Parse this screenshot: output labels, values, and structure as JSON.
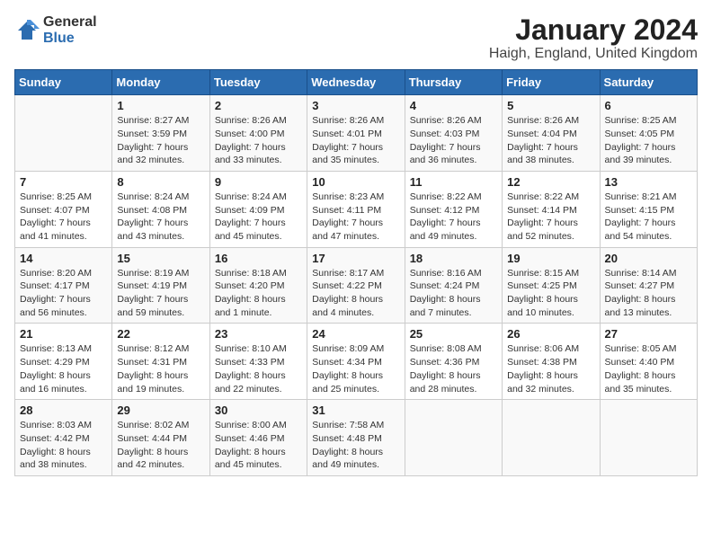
{
  "logo": {
    "general": "General",
    "blue": "Blue"
  },
  "header": {
    "title": "January 2024",
    "subtitle": "Haigh, England, United Kingdom"
  },
  "weekdays": [
    "Sunday",
    "Monday",
    "Tuesday",
    "Wednesday",
    "Thursday",
    "Friday",
    "Saturday"
  ],
  "weeks": [
    [
      {
        "day": "",
        "info": ""
      },
      {
        "day": "1",
        "info": "Sunrise: 8:27 AM\nSunset: 3:59 PM\nDaylight: 7 hours\nand 32 minutes."
      },
      {
        "day": "2",
        "info": "Sunrise: 8:26 AM\nSunset: 4:00 PM\nDaylight: 7 hours\nand 33 minutes."
      },
      {
        "day": "3",
        "info": "Sunrise: 8:26 AM\nSunset: 4:01 PM\nDaylight: 7 hours\nand 35 minutes."
      },
      {
        "day": "4",
        "info": "Sunrise: 8:26 AM\nSunset: 4:03 PM\nDaylight: 7 hours\nand 36 minutes."
      },
      {
        "day": "5",
        "info": "Sunrise: 8:26 AM\nSunset: 4:04 PM\nDaylight: 7 hours\nand 38 minutes."
      },
      {
        "day": "6",
        "info": "Sunrise: 8:25 AM\nSunset: 4:05 PM\nDaylight: 7 hours\nand 39 minutes."
      }
    ],
    [
      {
        "day": "7",
        "info": "Sunrise: 8:25 AM\nSunset: 4:07 PM\nDaylight: 7 hours\nand 41 minutes."
      },
      {
        "day": "8",
        "info": "Sunrise: 8:24 AM\nSunset: 4:08 PM\nDaylight: 7 hours\nand 43 minutes."
      },
      {
        "day": "9",
        "info": "Sunrise: 8:24 AM\nSunset: 4:09 PM\nDaylight: 7 hours\nand 45 minutes."
      },
      {
        "day": "10",
        "info": "Sunrise: 8:23 AM\nSunset: 4:11 PM\nDaylight: 7 hours\nand 47 minutes."
      },
      {
        "day": "11",
        "info": "Sunrise: 8:22 AM\nSunset: 4:12 PM\nDaylight: 7 hours\nand 49 minutes."
      },
      {
        "day": "12",
        "info": "Sunrise: 8:22 AM\nSunset: 4:14 PM\nDaylight: 7 hours\nand 52 minutes."
      },
      {
        "day": "13",
        "info": "Sunrise: 8:21 AM\nSunset: 4:15 PM\nDaylight: 7 hours\nand 54 minutes."
      }
    ],
    [
      {
        "day": "14",
        "info": "Sunrise: 8:20 AM\nSunset: 4:17 PM\nDaylight: 7 hours\nand 56 minutes."
      },
      {
        "day": "15",
        "info": "Sunrise: 8:19 AM\nSunset: 4:19 PM\nDaylight: 7 hours\nand 59 minutes."
      },
      {
        "day": "16",
        "info": "Sunrise: 8:18 AM\nSunset: 4:20 PM\nDaylight: 8 hours\nand 1 minute."
      },
      {
        "day": "17",
        "info": "Sunrise: 8:17 AM\nSunset: 4:22 PM\nDaylight: 8 hours\nand 4 minutes."
      },
      {
        "day": "18",
        "info": "Sunrise: 8:16 AM\nSunset: 4:24 PM\nDaylight: 8 hours\nand 7 minutes."
      },
      {
        "day": "19",
        "info": "Sunrise: 8:15 AM\nSunset: 4:25 PM\nDaylight: 8 hours\nand 10 minutes."
      },
      {
        "day": "20",
        "info": "Sunrise: 8:14 AM\nSunset: 4:27 PM\nDaylight: 8 hours\nand 13 minutes."
      }
    ],
    [
      {
        "day": "21",
        "info": "Sunrise: 8:13 AM\nSunset: 4:29 PM\nDaylight: 8 hours\nand 16 minutes."
      },
      {
        "day": "22",
        "info": "Sunrise: 8:12 AM\nSunset: 4:31 PM\nDaylight: 8 hours\nand 19 minutes."
      },
      {
        "day": "23",
        "info": "Sunrise: 8:10 AM\nSunset: 4:33 PM\nDaylight: 8 hours\nand 22 minutes."
      },
      {
        "day": "24",
        "info": "Sunrise: 8:09 AM\nSunset: 4:34 PM\nDaylight: 8 hours\nand 25 minutes."
      },
      {
        "day": "25",
        "info": "Sunrise: 8:08 AM\nSunset: 4:36 PM\nDaylight: 8 hours\nand 28 minutes."
      },
      {
        "day": "26",
        "info": "Sunrise: 8:06 AM\nSunset: 4:38 PM\nDaylight: 8 hours\nand 32 minutes."
      },
      {
        "day": "27",
        "info": "Sunrise: 8:05 AM\nSunset: 4:40 PM\nDaylight: 8 hours\nand 35 minutes."
      }
    ],
    [
      {
        "day": "28",
        "info": "Sunrise: 8:03 AM\nSunset: 4:42 PM\nDaylight: 8 hours\nand 38 minutes."
      },
      {
        "day": "29",
        "info": "Sunrise: 8:02 AM\nSunset: 4:44 PM\nDaylight: 8 hours\nand 42 minutes."
      },
      {
        "day": "30",
        "info": "Sunrise: 8:00 AM\nSunset: 4:46 PM\nDaylight: 8 hours\nand 45 minutes."
      },
      {
        "day": "31",
        "info": "Sunrise: 7:58 AM\nSunset: 4:48 PM\nDaylight: 8 hours\nand 49 minutes."
      },
      {
        "day": "",
        "info": ""
      },
      {
        "day": "",
        "info": ""
      },
      {
        "day": "",
        "info": ""
      }
    ]
  ]
}
